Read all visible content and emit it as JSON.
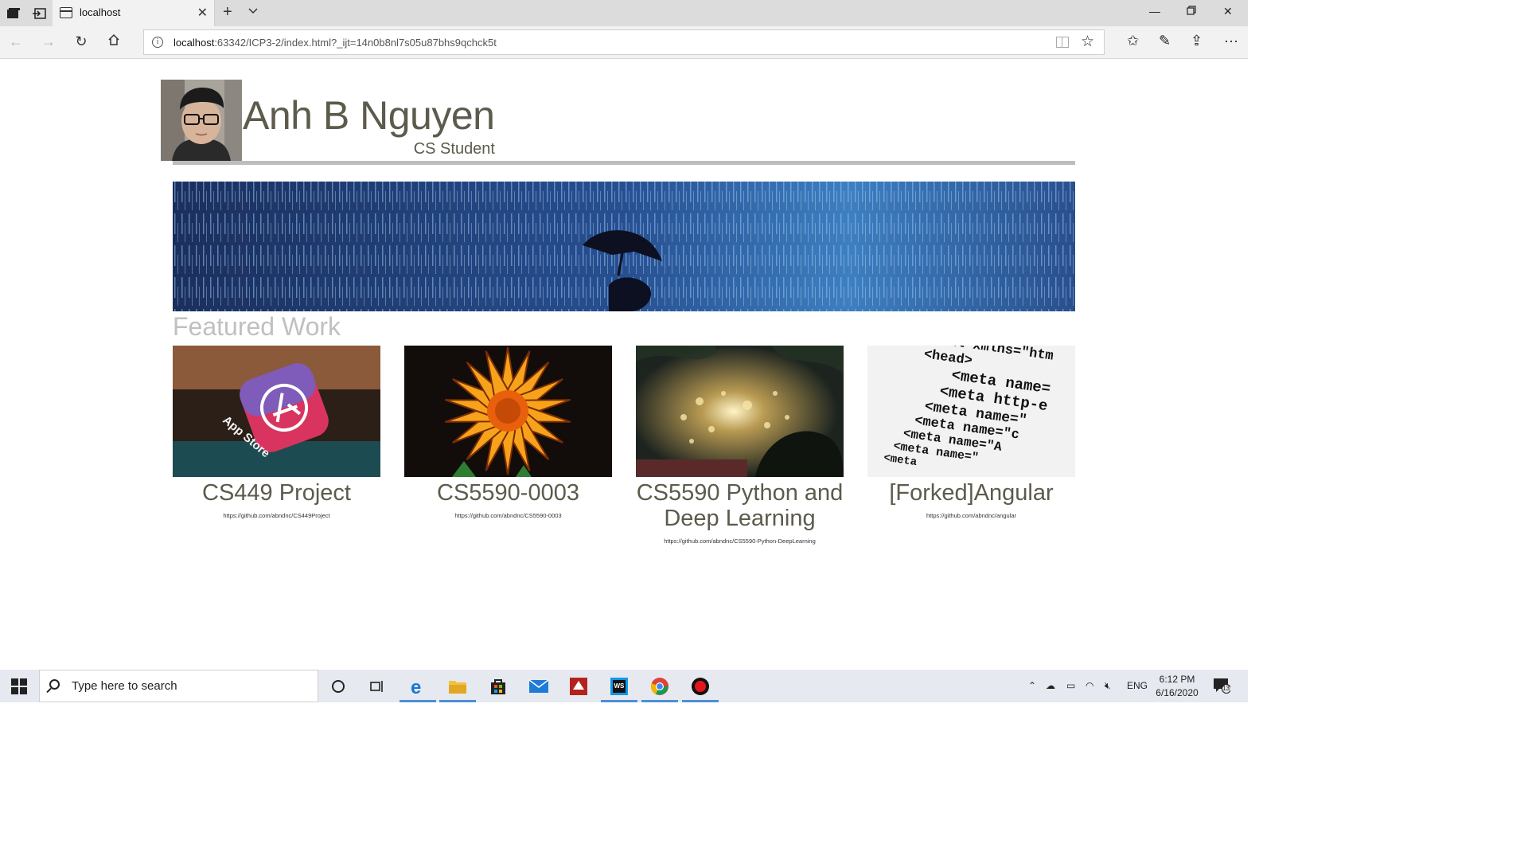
{
  "browser": {
    "tab_title": "localhost",
    "url_host": "localhost",
    "url_rest": ":63342/ICP3-2/index.html?_ijt=14n0b8nl7s05u87bhs9qchck5t"
  },
  "profile": {
    "name": "Anh B Nguyen",
    "subtitle": "CS Student"
  },
  "featured_heading": "Featured Work",
  "projects": [
    {
      "title": "CS449 Project",
      "link": "https://github.com/abndnc/CS449Project"
    },
    {
      "title": "CS5590-0003",
      "link": "https://github.com/abndnc/CS5590-0003"
    },
    {
      "title": "CS5590 Python and Deep Learning",
      "link": "https://github.com/abndnc/CS5590-Python-DeepLearning"
    },
    {
      "title": "[Forked]Angular",
      "link": "https://github.com/abndnc/angular"
    }
  ],
  "code_snippet": [
    "<html xmlns=\"htm",
    "<head>",
    "<meta name=",
    "<meta http-e",
    "<meta name=\"",
    "<meta name=\"c",
    "<meta name=\"A",
    "<meta name=\"",
    "<meta"
  ],
  "app_store_label": "App Store",
  "taskbar": {
    "search_placeholder": "Type here to search",
    "language": "ENG",
    "time": "6:12 PM",
    "date": "6/16/2020",
    "notifications": "13"
  }
}
